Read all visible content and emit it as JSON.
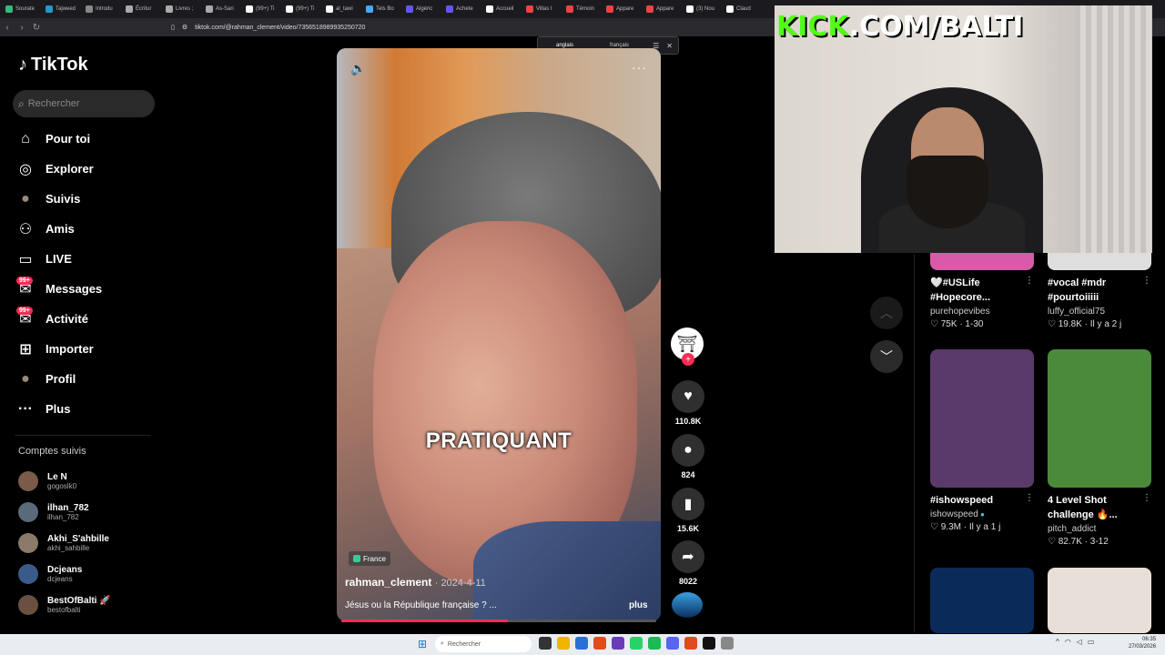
{
  "browser": {
    "tabs": [
      {
        "label": "Sourate",
        "color": "#3b7"
      },
      {
        "label": "Tajweed",
        "color": "#29c"
      },
      {
        "label": "Introdu",
        "color": "#888"
      },
      {
        "label": "Écritur",
        "color": "#aaa"
      },
      {
        "label": "Livres ;",
        "color": "#aaa"
      },
      {
        "label": "As-Sari",
        "color": "#aaa"
      },
      {
        "label": "(99+) Ti",
        "color": "#fff"
      },
      {
        "label": "(99+) Ti",
        "color": "#fff"
      },
      {
        "label": "al_tawi",
        "color": "#fff"
      },
      {
        "label": "Tels Bo",
        "color": "#4af"
      },
      {
        "label": "Algéric",
        "color": "#65f"
      },
      {
        "label": "Achete",
        "color": "#65f"
      },
      {
        "label": "Accueil",
        "color": "#fff"
      },
      {
        "label": "Villas I",
        "color": "#e44"
      },
      {
        "label": "Témoin",
        "color": "#e44"
      },
      {
        "label": "Appare",
        "color": "#e44"
      },
      {
        "label": "Appare",
        "color": "#e44"
      },
      {
        "label": "(3) Nou",
        "color": "#fff"
      },
      {
        "label": "Claud",
        "color": "#fff"
      }
    ],
    "url": "tiktok.com/@rahman_clement/video/7356518989935250720"
  },
  "translate_popup": {
    "source_lang": "anglais",
    "target_lang": "français"
  },
  "tiktok": {
    "logo": "TikTok",
    "search_placeholder": "Rechercher",
    "nav": [
      {
        "label": "Pour toi",
        "icon": "home-icon",
        "glyph": "⌂"
      },
      {
        "label": "Explorer",
        "icon": "compass-icon",
        "glyph": "◎"
      },
      {
        "label": "Suivis",
        "icon": "avatar-icon",
        "glyph": "●"
      },
      {
        "label": "Amis",
        "icon": "friends-icon",
        "glyph": "⚇"
      },
      {
        "label": "LIVE",
        "icon": "live-icon",
        "glyph": "▭"
      },
      {
        "label": "Messages",
        "icon": "messages-icon",
        "glyph": "✉",
        "badge": "99+"
      },
      {
        "label": "Activité",
        "icon": "activity-icon",
        "glyph": "✉",
        "badge": "99+"
      },
      {
        "label": "Importer",
        "icon": "upload-icon",
        "glyph": "⊞"
      },
      {
        "label": "Profil",
        "icon": "profile-icon",
        "glyph": "●"
      },
      {
        "label": "Plus",
        "icon": "more-icon",
        "glyph": "···"
      }
    ],
    "following_title": "Comptes suivis",
    "following": [
      {
        "name": "Le N",
        "handle": "gogoslk0"
      },
      {
        "name": "ilhan_782",
        "handle": "ilhan_782"
      },
      {
        "name": "Akhi_S'ahbille",
        "handle": "akhi_sahbille"
      },
      {
        "name": "Dcjeans",
        "handle": "dcjeans"
      },
      {
        "name": "BestOfBalti 🚀",
        "handle": "bestofbalti"
      }
    ]
  },
  "video": {
    "caption_word": "PRATIQUANT",
    "location": "France",
    "author": "rahman_clement",
    "date": "· 2024-4-11",
    "description": "Jésus ou la République française ? ...",
    "more": "plus",
    "progress": 0.53,
    "likes": "110.8K",
    "comments": "824",
    "saves": "15.6K",
    "shares": "8022"
  },
  "suggestions": [
    {
      "title_lines": [
        "🤍#USLife",
        "#Hopecore..."
      ],
      "user": "purehopevibes",
      "meta": "♡ 75K · 1-30",
      "thumb_color": "#d85aa8",
      "verified": false
    },
    {
      "title_lines": [
        "#vocal #mdr",
        "#pourtoiiiii"
      ],
      "user": "luffy_official75",
      "meta": "♡ 19.8K · Il y a 2 j",
      "thumb_color": "#dedede",
      "verified": false
    },
    {
      "title_lines": [
        "#ishowspeed"
      ],
      "user": "ishowspeed",
      "meta": "♡ 9.3M · Il y a 1 j",
      "thumb_color": "#5a3a6a",
      "verified": true
    },
    {
      "title_lines": [
        "4 Level Shot",
        "challenge 🔥..."
      ],
      "user": "pitch_addict",
      "meta": "♡ 82.7K · 3-12",
      "thumb_color": "#4b8a3a",
      "verified": false
    },
    {
      "title_lines": [],
      "user": "",
      "meta": "",
      "thumb_color": "#0a2a5a",
      "verified": false
    },
    {
      "title_lines": [],
      "user": "",
      "meta": "",
      "thumb_color": "#e8e0d8",
      "verified": false
    }
  ],
  "overlay": {
    "kick_prefix": "KICK",
    "kick_rest": ".COM/BALTI"
  },
  "taskbar": {
    "search_placeholder": "Rechercher",
    "time": "06:35",
    "date": "27/03/2026"
  }
}
